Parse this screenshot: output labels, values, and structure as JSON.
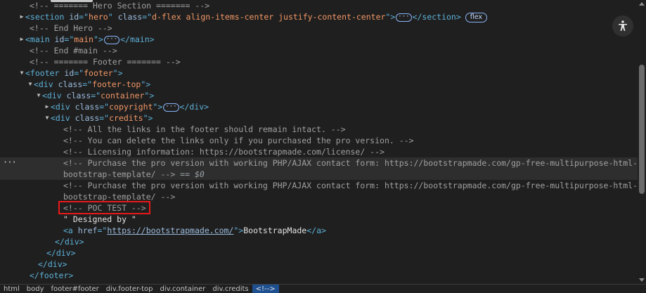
{
  "lines": [
    {
      "indent": 42,
      "arrow": "",
      "parts": [
        [
          "c",
          "<!-- ======= Hero Section ======= -->"
        ]
      ]
    },
    {
      "indent": 36,
      "arrow": "right",
      "parts": [
        [
          "t",
          "<section "
        ],
        [
          "a",
          "id"
        ],
        [
          "t",
          "=\""
        ],
        [
          "v",
          "hero"
        ],
        [
          "t",
          "\" "
        ],
        [
          "a",
          "class"
        ],
        [
          "t",
          "=\""
        ],
        [
          "v",
          "d-flex align-items-center justify-content-center"
        ],
        [
          "t",
          "\">"
        ],
        [
          "ell",
          "···"
        ],
        [
          "t",
          "</section>"
        ]
      ],
      "badge": "flex"
    },
    {
      "indent": 42,
      "arrow": "",
      "parts": [
        [
          "c",
          "<!-- End Hero -->"
        ]
      ]
    },
    {
      "indent": 36,
      "arrow": "right",
      "parts": [
        [
          "t",
          "<main "
        ],
        [
          "a",
          "id"
        ],
        [
          "t",
          "=\""
        ],
        [
          "v",
          "main"
        ],
        [
          "t",
          "\">"
        ],
        [
          "ell",
          "···"
        ],
        [
          "t",
          "</main>"
        ]
      ]
    },
    {
      "indent": 42,
      "arrow": "",
      "parts": [
        [
          "c",
          "<!-- End #main -->"
        ]
      ]
    },
    {
      "indent": 42,
      "arrow": "",
      "parts": [
        [
          "c",
          "<!-- ======= Footer ======= -->"
        ]
      ]
    },
    {
      "indent": 36,
      "arrow": "down",
      "parts": [
        [
          "t",
          "<footer "
        ],
        [
          "a",
          "id"
        ],
        [
          "t",
          "=\""
        ],
        [
          "v",
          "footer"
        ],
        [
          "t",
          "\">"
        ]
      ]
    },
    {
      "indent": 48,
      "arrow": "down",
      "parts": [
        [
          "t",
          "<div "
        ],
        [
          "a",
          "class"
        ],
        [
          "t",
          "=\""
        ],
        [
          "v",
          "footer-top"
        ],
        [
          "t",
          "\">"
        ]
      ]
    },
    {
      "indent": 60,
      "arrow": "down",
      "parts": [
        [
          "t",
          "<div "
        ],
        [
          "a",
          "class"
        ],
        [
          "t",
          "=\""
        ],
        [
          "v",
          "container"
        ],
        [
          "t",
          "\">"
        ]
      ]
    },
    {
      "indent": 72,
      "arrow": "right",
      "parts": [
        [
          "t",
          "<div "
        ],
        [
          "a",
          "class"
        ],
        [
          "t",
          "=\""
        ],
        [
          "v",
          "copyright"
        ],
        [
          "t",
          "\">"
        ],
        [
          "ell",
          "···"
        ],
        [
          "t",
          "</div>"
        ]
      ]
    },
    {
      "indent": 72,
      "arrow": "down",
      "parts": [
        [
          "t",
          "<div "
        ],
        [
          "a",
          "class"
        ],
        [
          "t",
          "=\""
        ],
        [
          "v",
          "credits"
        ],
        [
          "t",
          "\">"
        ]
      ]
    },
    {
      "indent": 90,
      "arrow": "",
      "parts": [
        [
          "c",
          "<!-- All the links in the footer should remain intact. -->"
        ]
      ]
    },
    {
      "indent": 90,
      "arrow": "",
      "parts": [
        [
          "c",
          "<!-- You can delete the links only if you purchased the pro version. -->"
        ]
      ]
    },
    {
      "indent": 90,
      "arrow": "",
      "parts": [
        [
          "c",
          "<!-- Licensing information: https://bootstrapmade.com/license/ -->"
        ]
      ]
    },
    {
      "indent": 90,
      "arrow": "",
      "hl": true,
      "parts": [
        [
          "c",
          "<!-- Purchase the pro version with working PHP/AJAX contact form: https://bootstrapmade.com/gp-free-multipurpose-html-"
        ]
      ]
    },
    {
      "indent": 90,
      "arrow": "",
      "hl": true,
      "parts": [
        [
          "c",
          "bootstrap-template/ -->"
        ],
        [
          "eq",
          " == $0"
        ]
      ]
    },
    {
      "indent": 90,
      "arrow": "",
      "parts": [
        [
          "c",
          "<!-- Purchase the pro version with working PHP/AJAX contact form: https://bootstrapmade.com/gp-free-multipurpose-html-"
        ]
      ]
    },
    {
      "indent": 90,
      "arrow": "",
      "parts": [
        [
          "c",
          "bootstrap-template/ -->"
        ]
      ]
    },
    {
      "indent": 90,
      "arrow": "",
      "parts": [
        [
          "c",
          "<!-- POC TEST -->"
        ]
      ]
    },
    {
      "indent": 90,
      "arrow": "",
      "parts": [
        [
          "txt",
          "\" Designed by \""
        ]
      ]
    },
    {
      "indent": 90,
      "arrow": "",
      "parts": [
        [
          "t",
          "<a "
        ],
        [
          "a",
          "href"
        ],
        [
          "t",
          "=\""
        ],
        [
          "u",
          "https://bootstrapmade.com/"
        ],
        [
          "t",
          "\">"
        ],
        [
          "txt",
          "BootstrapMade"
        ],
        [
          "t",
          "</a>"
        ]
      ]
    },
    {
      "indent": 78,
      "arrow": "",
      "parts": [
        [
          "t",
          "</div>"
        ]
      ]
    },
    {
      "indent": 66,
      "arrow": "",
      "parts": [
        [
          "t",
          "</div>"
        ]
      ]
    },
    {
      "indent": 54,
      "arrow": "",
      "parts": [
        [
          "t",
          "</div>"
        ]
      ]
    },
    {
      "indent": 42,
      "arrow": "",
      "parts": [
        [
          "t",
          "</footer>"
        ]
      ]
    }
  ],
  "breadcrumbs": [
    "html",
    "body",
    "footer#footer",
    "div.footer-top",
    "div.container",
    "div.credits",
    "<!-->"
  ],
  "active_breadcrumb": 6,
  "gutter_marker": "···",
  "accessibility_icon": "accessibility-icon"
}
